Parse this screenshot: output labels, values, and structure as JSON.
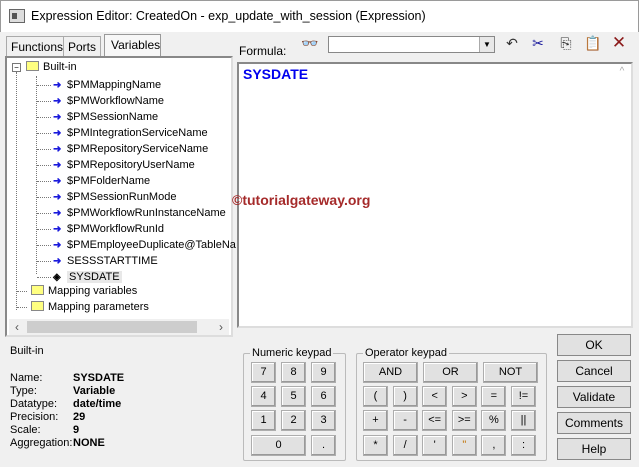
{
  "window": {
    "title": "Expression Editor: CreatedOn - exp_update_with_session (Expression)"
  },
  "tabs": [
    "Functions",
    "Ports",
    "Variables"
  ],
  "tree": {
    "root": "Built-in",
    "items": [
      {
        "label": "$PMMappingName",
        "icon": "arrow-right-icon"
      },
      {
        "label": "$PMWorkflowName",
        "icon": "arrow-right-icon"
      },
      {
        "label": "$PMSessionName",
        "icon": "arrow-right-icon"
      },
      {
        "label": "$PMIntegrationServiceName",
        "icon": "arrow-right-icon"
      },
      {
        "label": "$PMRepositoryServiceName",
        "icon": "arrow-right-icon"
      },
      {
        "label": "$PMRepositoryUserName",
        "icon": "arrow-right-icon"
      },
      {
        "label": "$PMFolderName",
        "icon": "arrow-right-icon"
      },
      {
        "label": "$PMSessionRunMode",
        "icon": "arrow-right-icon"
      },
      {
        "label": "$PMWorkflowRunInstanceName",
        "icon": "arrow-right-icon"
      },
      {
        "label": "$PMWorkflowRunId",
        "icon": "arrow-right-icon"
      },
      {
        "label": "$PMEmployeeDuplicate@TableNa",
        "icon": "arrow-right-icon"
      },
      {
        "label": "SESSSTARTTIME",
        "icon": "arrow-right-icon"
      },
      {
        "label": "SYSDATE",
        "icon": "diamond-icon"
      }
    ],
    "folders": [
      "Mapping variables",
      "Mapping parameters"
    ]
  },
  "formula": {
    "label": "Formula:",
    "text": "SYSDATE",
    "search_value": ""
  },
  "watermark": "©tutorialgateway.org",
  "info": {
    "category": "Built-in",
    "fields": [
      {
        "label": "Name:",
        "value": "SYSDATE"
      },
      {
        "label": "Type:",
        "value": "Variable"
      },
      {
        "label": "Datatype:",
        "value": "date/time"
      },
      {
        "label": "Precision:",
        "value": "29"
      },
      {
        "label": "Scale:",
        "value": "9"
      },
      {
        "label": "Aggregation:",
        "value": "NONE"
      }
    ]
  },
  "numeric_keypad": {
    "label": "Numeric keypad",
    "keys": [
      "7",
      "8",
      "9",
      "4",
      "5",
      "6",
      "1",
      "2",
      "3",
      "0",
      "."
    ]
  },
  "operator_keypad": {
    "label": "Operator keypad",
    "top": [
      "AND",
      "OR",
      "NOT"
    ],
    "keys": [
      "(",
      ")",
      "<",
      ">",
      "=",
      "!=",
      "+",
      "-",
      "<=",
      ">=",
      "%",
      "||",
      "*",
      "/",
      "'",
      "\"",
      ",",
      ":"
    ]
  },
  "actions": [
    "OK",
    "Cancel",
    "Validate",
    "Comments",
    "Help"
  ]
}
